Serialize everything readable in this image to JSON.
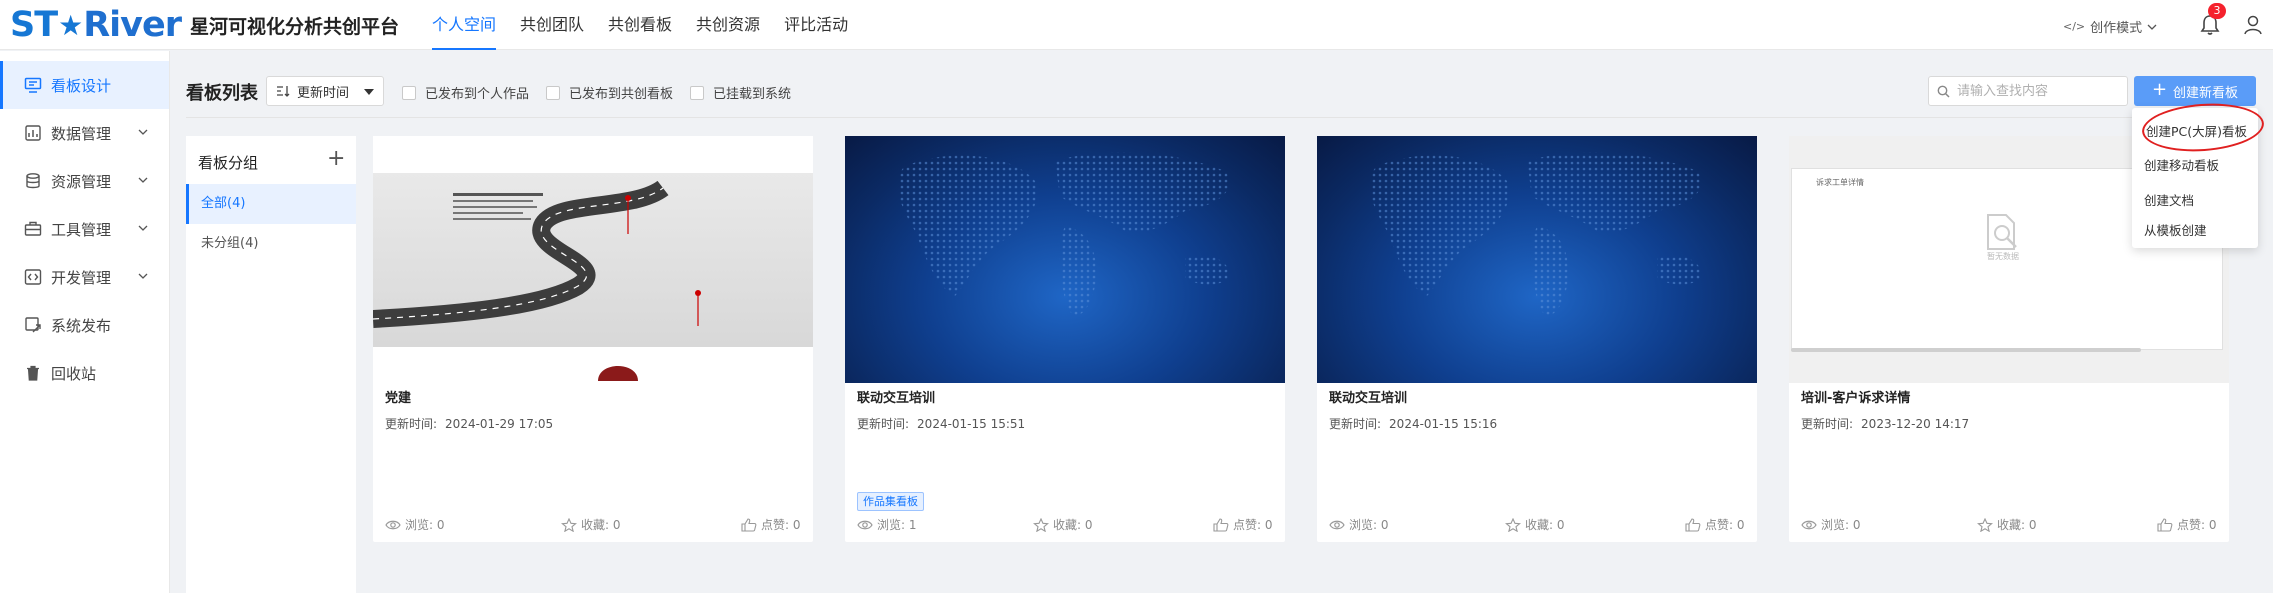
{
  "header": {
    "logo_text_a": "ST",
    "logo_star": "★",
    "logo_text_b": "River",
    "platform_title": "星河可视化分析共创平台",
    "nav": [
      {
        "label": "个人空间",
        "active": true
      },
      {
        "label": "共创团队"
      },
      {
        "label": "共创看板"
      },
      {
        "label": "共创资源"
      },
      {
        "label": "评比活动"
      }
    ],
    "mode_label": "创作模式",
    "notification_count": "3"
  },
  "sidebar": {
    "items": [
      {
        "label": "看板设计",
        "icon": "monitor-icon",
        "active": true
      },
      {
        "label": "数据管理",
        "icon": "data-icon",
        "expandable": true
      },
      {
        "label": "资源管理",
        "icon": "database-icon",
        "expandable": true
      },
      {
        "label": "工具管理",
        "icon": "toolbox-icon",
        "expandable": true
      },
      {
        "label": "开发管理",
        "icon": "code-icon",
        "expandable": true
      },
      {
        "label": "系统发布",
        "icon": "publish-icon"
      },
      {
        "label": "回收站",
        "icon": "trash-icon"
      }
    ]
  },
  "toolbar": {
    "title": "看板列表",
    "sort_value": "更新时间",
    "filters": [
      "已发布到个人作品",
      "已发布到共创看板",
      "已挂载到系统"
    ],
    "search_placeholder": "请输入查找内容",
    "create_label": "创建新看板"
  },
  "groups": {
    "title": "看板分组",
    "items": [
      {
        "label": "全部(4)",
        "active": true
      },
      {
        "label": "未分组(4)"
      }
    ]
  },
  "stat_labels": {
    "views": "浏览",
    "favorites": "收藏",
    "likes": "点赞"
  },
  "time_label": "更新时间:",
  "cards": [
    {
      "title": "党建",
      "time": "2024-01-29 17:05",
      "views": "浏览: 0",
      "favorites": "收藏: 0",
      "likes": "点赞: 0",
      "thumb": "road"
    },
    {
      "title": "联动交互培训",
      "time": "2024-01-15 15:51",
      "tag": "作品集看板",
      "views": "浏览: 1",
      "favorites": "收藏: 0",
      "likes": "点赞: 0",
      "thumb": "map"
    },
    {
      "title": "联动交互培训",
      "time": "2024-01-15 15:16",
      "views": "浏览: 0",
      "favorites": "收藏: 0",
      "likes": "点赞: 0",
      "thumb": "map"
    },
    {
      "title": "培训-客户诉求详情",
      "time": "2023-12-20 14:17",
      "views": "浏览: 0",
      "favorites": "收藏: 0",
      "likes": "点赞: 0",
      "thumb": "form",
      "thumb_title": "诉求工单详情",
      "thumb_nodata": "暂无数据"
    }
  ],
  "dropdown": {
    "items": [
      "创建PC(大屏)看板",
      "创建移动看板",
      "创建文档",
      "从模板创建"
    ]
  },
  "colors": {
    "accent": "#1677ff",
    "button": "#5a9cf8",
    "badge": "#f5222d",
    "highlight_ring": "#e02020"
  }
}
